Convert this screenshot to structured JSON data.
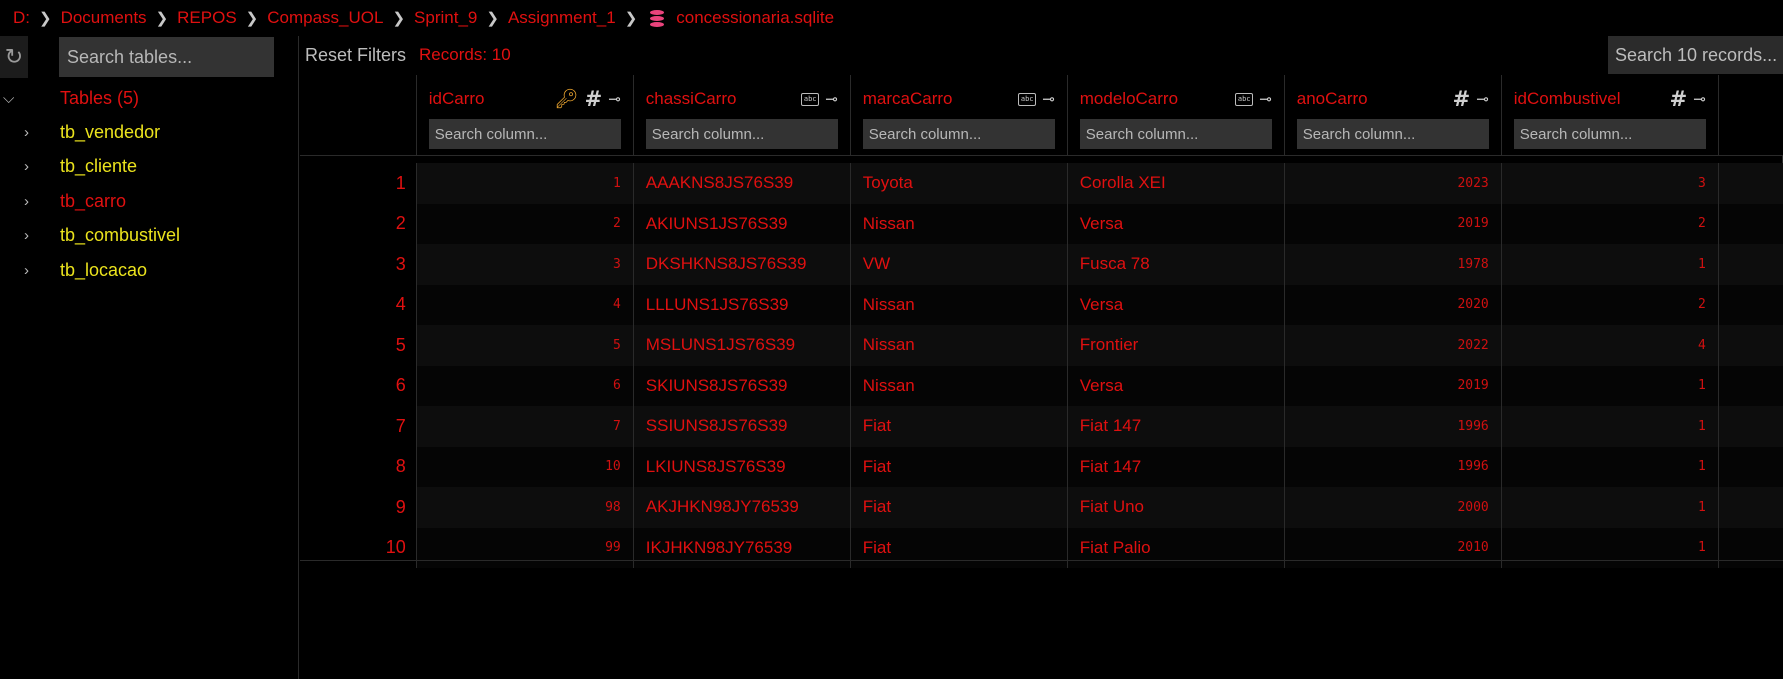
{
  "breadcrumb": {
    "parts": [
      "D:",
      "Documents",
      "REPOS",
      "Compass_UOL",
      "Sprint_9",
      "Assignment_1"
    ],
    "file": "concessionaria.sqlite"
  },
  "sidebar": {
    "search_placeholder": "Search tables...",
    "root_label": "Tables (5)",
    "items": [
      {
        "label": "tb_vendedor"
      },
      {
        "label": "tb_cliente"
      },
      {
        "label": "tb_carro"
      },
      {
        "label": "tb_combustivel"
      },
      {
        "label": "tb_locacao"
      }
    ]
  },
  "toolbar": {
    "reset_label": "Reset Filters",
    "records_label": "Records: 10",
    "search_placeholder": "Search 10 records..."
  },
  "columns": [
    {
      "name": "idCarro",
      "placeholder": "Search column..."
    },
    {
      "name": "chassiCarro",
      "placeholder": "Search column..."
    },
    {
      "name": "marcaCarro",
      "placeholder": "Search column..."
    },
    {
      "name": "modeloCarro",
      "placeholder": "Search column..."
    },
    {
      "name": "anoCarro",
      "placeholder": "Search column..."
    },
    {
      "name": "idCombustivel",
      "placeholder": "Search column..."
    }
  ],
  "rows": [
    {
      "n": "1",
      "idCarro": "1",
      "chassi": "AAAKNS8JS76S39",
      "marca": "Toyota",
      "modelo": "Corolla XEI",
      "ano": "2023",
      "idComb": "3"
    },
    {
      "n": "2",
      "idCarro": "2",
      "chassi": "AKIUNS1JS76S39",
      "marca": "Nissan",
      "modelo": "Versa",
      "ano": "2019",
      "idComb": "2"
    },
    {
      "n": "3",
      "idCarro": "3",
      "chassi": "DKSHKNS8JS76S39",
      "marca": "VW",
      "modelo": "Fusca 78",
      "ano": "1978",
      "idComb": "1"
    },
    {
      "n": "4",
      "idCarro": "4",
      "chassi": "LLLUNS1JS76S39",
      "marca": "Nissan",
      "modelo": "Versa",
      "ano": "2020",
      "idComb": "2"
    },
    {
      "n": "5",
      "idCarro": "5",
      "chassi": "MSLUNS1JS76S39",
      "marca": "Nissan",
      "modelo": "Frontier",
      "ano": "2022",
      "idComb": "4"
    },
    {
      "n": "6",
      "idCarro": "6",
      "chassi": "SKIUNS8JS76S39",
      "marca": "Nissan",
      "modelo": "Versa",
      "ano": "2019",
      "idComb": "1"
    },
    {
      "n": "7",
      "idCarro": "7",
      "chassi": "SSIUNS8JS76S39",
      "marca": "Fiat",
      "modelo": "Fiat 147",
      "ano": "1996",
      "idComb": "1"
    },
    {
      "n": "8",
      "idCarro": "10",
      "chassi": "LKIUNS8JS76S39",
      "marca": "Fiat",
      "modelo": "Fiat 147",
      "ano": "1996",
      "idComb": "1"
    },
    {
      "n": "9",
      "idCarro": "98",
      "chassi": "AKJHKN98JY76539",
      "marca": "Fiat",
      "modelo": "Fiat Uno",
      "ano": "2000",
      "idComb": "1"
    },
    {
      "n": "10",
      "idCarro": "99",
      "chassi": "IKJHKN98JY76539",
      "marca": "Fiat",
      "modelo": "Fiat Palio",
      "ano": "2010",
      "idComb": "1"
    }
  ]
}
